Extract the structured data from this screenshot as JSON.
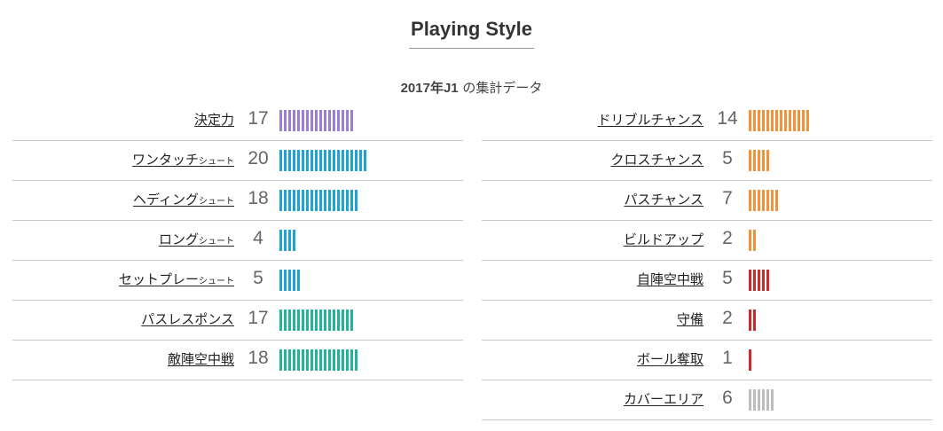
{
  "title": "Playing Style",
  "subtitle_bold": "2017年J1",
  "subtitle_rest": " の集計データ",
  "colors": {
    "purple": "#9b7fd4",
    "blue": "#1fa3d6",
    "teal": "#22b39a",
    "orange": "#f2923a",
    "red": "#cc2b2b",
    "gray": "#bdbdbd"
  },
  "chart_data": {
    "type": "bar",
    "left": [
      {
        "label": "決定力",
        "suffix": "",
        "value": 17,
        "color": "purple"
      },
      {
        "label": "ワンタッチ",
        "suffix": "シュート",
        "value": 20,
        "color": "blue"
      },
      {
        "label": "ヘディング",
        "suffix": "シュート",
        "value": 18,
        "color": "blue"
      },
      {
        "label": "ロング",
        "suffix": "シュート",
        "value": 4,
        "color": "blue"
      },
      {
        "label": "セットプレー",
        "suffix": "シュート",
        "value": 5,
        "color": "blue"
      },
      {
        "label": "パスレスポンス",
        "suffix": "",
        "value": 17,
        "color": "teal"
      },
      {
        "label": "敵陣空中戦",
        "suffix": "",
        "value": 18,
        "color": "teal"
      }
    ],
    "right": [
      {
        "label": "ドリブルチャンス",
        "suffix": "",
        "value": 14,
        "color": "orange"
      },
      {
        "label": "クロスチャンス",
        "suffix": "",
        "value": 5,
        "color": "orange"
      },
      {
        "label": "パスチャンス",
        "suffix": "",
        "value": 7,
        "color": "orange"
      },
      {
        "label": "ビルドアップ",
        "suffix": "",
        "value": 2,
        "color": "orange"
      },
      {
        "label": "自陣空中戦",
        "suffix": "",
        "value": 5,
        "color": "red"
      },
      {
        "label": "守備",
        "suffix": "",
        "value": 2,
        "color": "red"
      },
      {
        "label": "ボール奪取",
        "suffix": "",
        "value": 1,
        "color": "red"
      },
      {
        "label": "カバーエリア",
        "suffix": "",
        "value": 6,
        "color": "gray"
      }
    ]
  }
}
